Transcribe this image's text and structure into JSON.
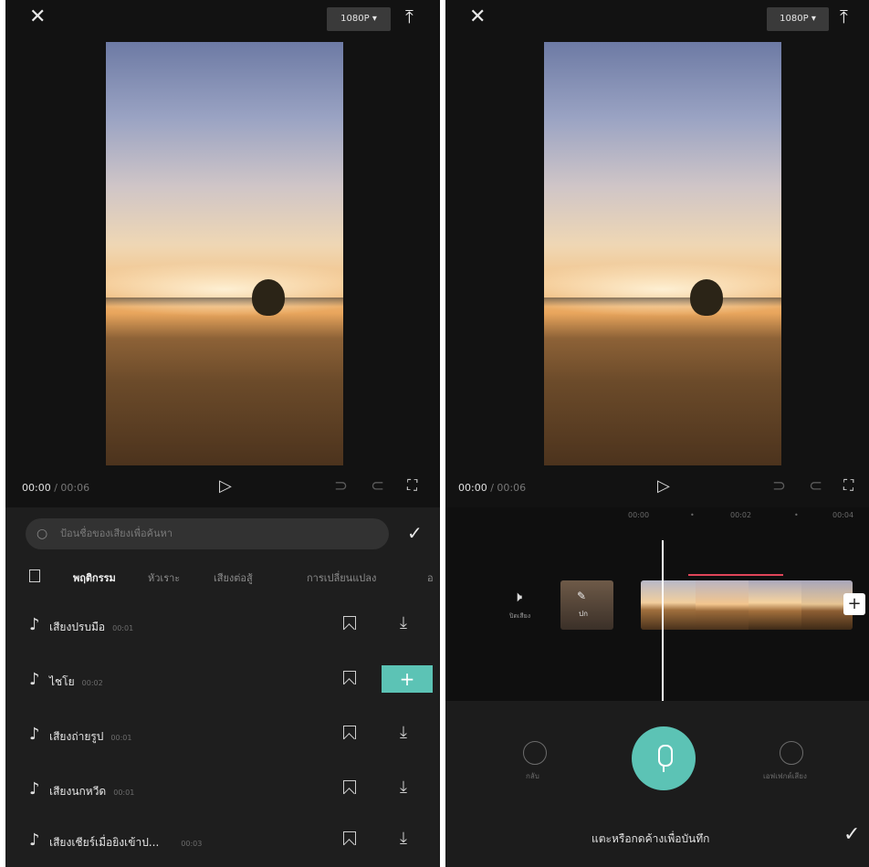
{
  "left_panel": {
    "resolution": "1080P ▾",
    "time_current": "00:00",
    "time_total": "/ 00:06",
    "search_placeholder": "ป้อนชื่อของเสียงเพื่อค้นหา",
    "tabs": [
      "พฤติกรรม",
      "หัวเราะ",
      "เสียงต่อสู้",
      "การเปลี่ยนแปลง",
      "อ"
    ],
    "sounds": [
      {
        "name": "เสียงปรบมือ",
        "duration": "00:01",
        "action": "download"
      },
      {
        "name": "ไชโย",
        "duration": "00:02",
        "action": "add"
      },
      {
        "name": "เสียงถ่ายรูป",
        "duration": "00:01",
        "action": "download"
      },
      {
        "name": "เสียงนกหวีด",
        "duration": "00:01",
        "action": "download"
      },
      {
        "name": "เสียงเชียร์เมื่อยิงเข้าป...",
        "duration": "00:03",
        "action": "download"
      }
    ]
  },
  "right_panel": {
    "resolution": "1080P ▾",
    "time_current": "00:00",
    "time_total": "/ 00:06",
    "ruler": [
      "00:00",
      "•",
      "00:02",
      "•",
      "00:04"
    ],
    "audio_label": "ปิดเสียง",
    "cover_label": "ปก",
    "undo_label": "กลับ",
    "voice_effect_label": "เอฟเฟกต์เสียง",
    "record_hint": "แตะหรือกดค้างเพื่อบันทึก"
  },
  "icons": {
    "close": "✕",
    "export": "⤒",
    "play": "▷",
    "undo": "⊃",
    "redo": "⊂",
    "fullscreen": "⛶",
    "search": "○",
    "check": "✓",
    "note": "♪",
    "download": "⤓",
    "plus": "+",
    "speaker": "🕨"
  },
  "colors": {
    "accent": "#5cc3b5",
    "bg": "#121212",
    "sheet": "#1e1e1e",
    "playhead_marker": "#e0455a"
  }
}
